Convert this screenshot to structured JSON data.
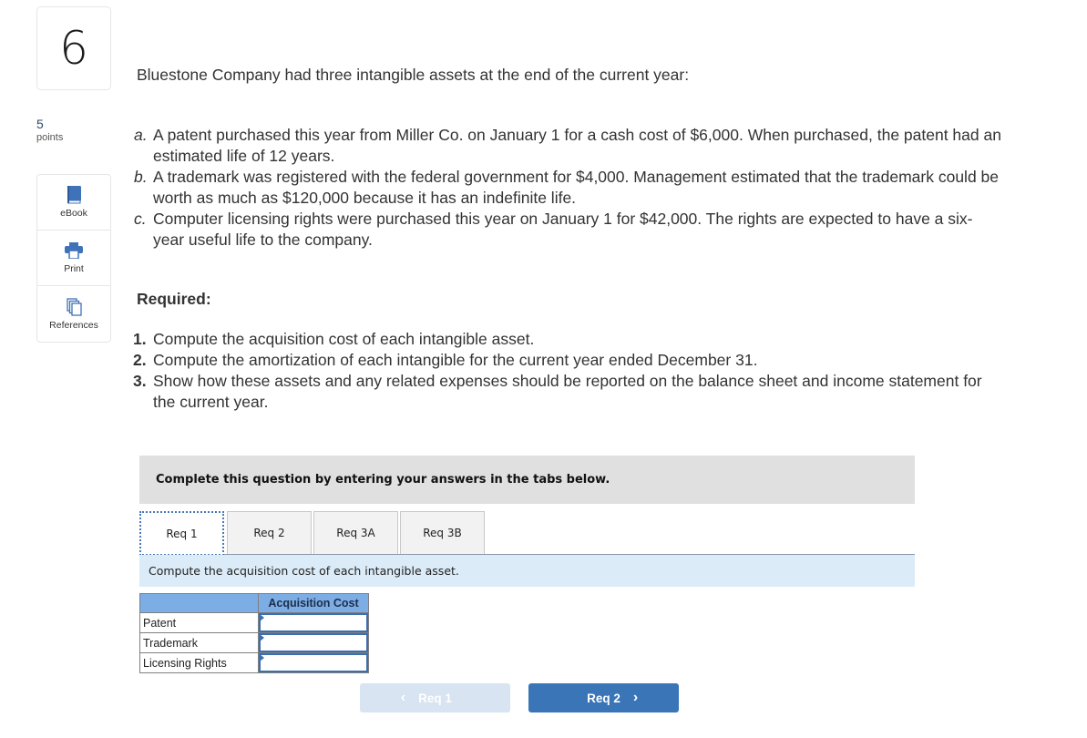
{
  "question": {
    "number": "6",
    "points_value": "5",
    "points_label": "points"
  },
  "tools": [
    {
      "label": "eBook",
      "icon": "book-icon"
    },
    {
      "label": "Print",
      "icon": "printer-icon"
    },
    {
      "label": "References",
      "icon": "references-icon"
    }
  ],
  "problem": {
    "intro": "Bluestone Company had three intangible assets at the end of the current year:",
    "items": [
      {
        "letter": "a.",
        "text": "A patent purchased this year from Miller Co. on January 1 for a cash cost of $6,000. When purchased, the patent had an estimated life of 12 years."
      },
      {
        "letter": "b.",
        "text": "A trademark was registered with the federal government for $4,000. Management estimated that the trademark could be worth as much as $120,000 because it has an indefinite life."
      },
      {
        "letter": "c.",
        "text": "Computer licensing rights were purchased this year on January 1 for $42,000. The rights are expected to have a six-year useful life to the company."
      }
    ],
    "required_label": "Required:",
    "requirements": [
      {
        "num": "1.",
        "text": "Compute the acquisition cost of each intangible asset."
      },
      {
        "num": "2.",
        "text": "Compute the amortization of each intangible for the current year ended December 31."
      },
      {
        "num": "3.",
        "text": "Show how these assets and any related expenses should be reported on the balance sheet and income statement for the current year."
      }
    ]
  },
  "widget": {
    "banner": "Complete this question by entering your answers in the tabs below.",
    "tabs": [
      {
        "label": "Req 1",
        "active": true
      },
      {
        "label": "Req 2",
        "active": false
      },
      {
        "label": "Req 3A",
        "active": false
      },
      {
        "label": "Req 3B",
        "active": false
      }
    ],
    "instruction": "Compute the acquisition cost of each intangible asset.",
    "table": {
      "header": [
        "",
        "Acquisition Cost"
      ],
      "rows": [
        {
          "label": "Patent",
          "value": ""
        },
        {
          "label": "Trademark",
          "value": ""
        },
        {
          "label": "Licensing Rights",
          "value": ""
        }
      ]
    },
    "prev_button": {
      "label": "Req 1",
      "icon": "chevron-left-icon",
      "enabled": false
    },
    "next_button": {
      "label": "Req 2",
      "icon": "chevron-right-icon",
      "enabled": true
    }
  },
  "colors": {
    "accent": "#3a75b8",
    "tab_header": "#7cade4",
    "instruction_bg": "#dbebf8",
    "banner_bg": "#e0e0e0",
    "disabled_button": "#d8e4f2"
  }
}
